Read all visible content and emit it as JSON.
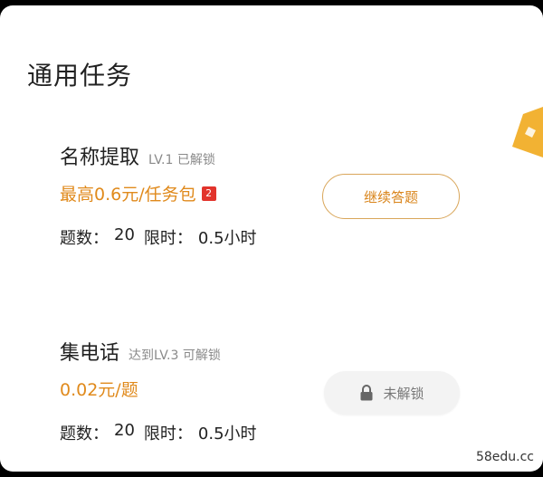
{
  "section": {
    "title": "通用任务"
  },
  "tasks": [
    {
      "name": "名称提取",
      "level": "LV.1 已解锁",
      "price": "最高0.6元/任务包",
      "badge": "2",
      "count_label": "题数：",
      "count": "20",
      "time_label": "限时：",
      "time": "0.5小时",
      "button_label": "继续答题",
      "locked": false
    },
    {
      "name": "集电话",
      "level": "达到LV.3 可解锁",
      "price": "0.02元/题",
      "count_label": "题数：",
      "count": "20",
      "time_label": "限时：",
      "time": "0.5小时",
      "button_label": "未解锁",
      "locked": true
    }
  ],
  "watermark": "58edu.cc",
  "colors": {
    "accent": "#e08a1c",
    "button_border": "#d9a65a",
    "badge_red": "#e2342c",
    "locked_bg": "#f3f3f3"
  }
}
